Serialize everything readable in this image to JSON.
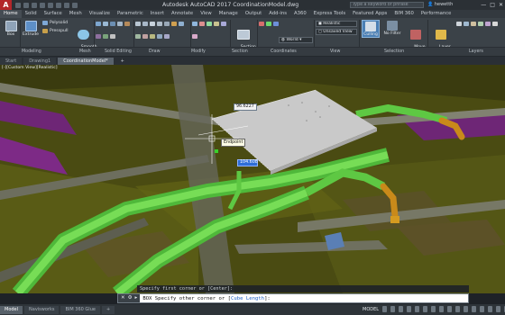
{
  "app": {
    "logo": "A",
    "title": "Autodesk AutoCAD 2017    CoordinationModel.dwg",
    "search_placeholder": "Type a keyword or phrase",
    "user": "hewetth",
    "window_controls": [
      "—",
      "□",
      "✕"
    ]
  },
  "ribbon_tabs": [
    "Home",
    "Solid",
    "Surface",
    "Mesh",
    "Visualize",
    "Parametric",
    "Insert",
    "Annotate",
    "View",
    "Manage",
    "Output",
    "Add-ins",
    "A360",
    "Express Tools",
    "Featured Apps",
    "BIM 360",
    "Performance"
  ],
  "active_ribbon_tab": "Home",
  "ribbon": {
    "box": "Box",
    "extrude": "Extrude",
    "polysolid": "Polysolid",
    "presspull": "Presspull",
    "smooth_object": "Smooth\nObject",
    "section_plane": "Section\nPlane",
    "world": "World",
    "visual_style": "Realistic",
    "view": "Unsaved View",
    "culling": "Culling",
    "no_filter": "No Filter",
    "move_gizmo": "Move\nGizmo",
    "layer_properties": "Layer\nProperties"
  },
  "panels": [
    "Modeling",
    "Mesh",
    "Solid Editing",
    "Draw",
    "Modify",
    "Section",
    "Coordinates",
    "View",
    "Selection",
    "Layers"
  ],
  "file_tabs": [
    "Start",
    "Drawing1",
    "CoordinationModel*",
    "+"
  ],
  "active_file_tab": "CoordinationModel*",
  "viewport": {
    "label": "[-][Custom View][Realistic]",
    "dim_value_1": "96.6227",
    "dim_value_2": "104.608",
    "snap_tooltip": "Endpoint"
  },
  "command": {
    "history": "Specify first corner or [Center]:",
    "prompt": "BOX Specify other corner or [Cube Length]:",
    "prompt_prefix": "BOX Specify other corner or [",
    "option_cube": "Cube",
    "option_length": "Length",
    "prompt_suffix": "]:"
  },
  "layout_tabs": [
    "Model",
    "Navisworks",
    "BIM 360 Glue",
    "+"
  ],
  "active_layout_tab": "Model",
  "status_model": "MODEL",
  "colors": {
    "duct_green": "#6ed84a",
    "structure_olive": "#5c5e16",
    "purple_slab": "#7d2a86",
    "gray_box": "#c9c9c9",
    "pipe_orange": "#c98a1a"
  }
}
